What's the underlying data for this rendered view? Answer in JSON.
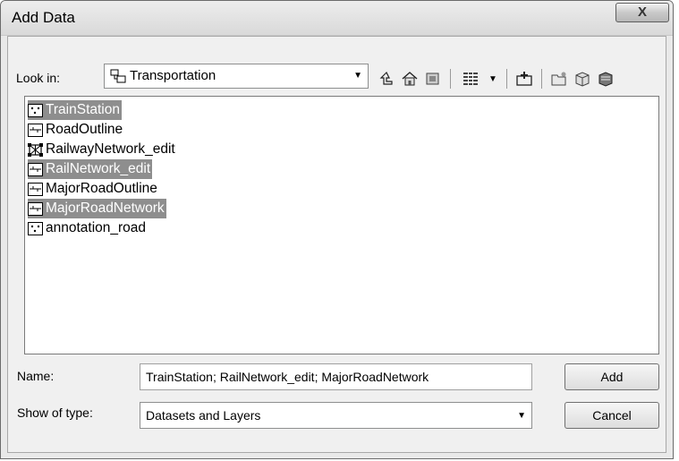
{
  "window": {
    "title": "Add Data",
    "close_label": "X"
  },
  "toolbar": {
    "look_in_label": "Look in:",
    "look_in_value": "Transportation",
    "buttons": [
      "up-one-level-icon",
      "home-icon",
      "catalog-icon",
      "view-options-icon",
      "new-folder-icon",
      "connect-folder-icon",
      "new-file-geodatabase-icon",
      "new-database-icon"
    ]
  },
  "list": {
    "items": [
      {
        "label": "TrainStation",
        "type": "point",
        "selected": true
      },
      {
        "label": "RoadOutline",
        "type": "line",
        "selected": false
      },
      {
        "label": "RailwayNetwork_edit",
        "type": "network",
        "selected": false
      },
      {
        "label": "RailNetwork_edit",
        "type": "line",
        "selected": true
      },
      {
        "label": "MajorRoadOutline",
        "type": "line",
        "selected": false
      },
      {
        "label": "MajorRoadNetwork",
        "type": "line",
        "selected": true
      },
      {
        "label": "annotation_road",
        "type": "point",
        "selected": false
      }
    ]
  },
  "form": {
    "name_label": "Name:",
    "name_value": "TrainStation; RailNetwork_edit; MajorRoadNetwork",
    "type_label": "Show of type:",
    "type_value": "Datasets and Layers"
  },
  "buttons": {
    "add": "Add",
    "cancel": "Cancel"
  },
  "colors": {
    "selection": "#8e8e8e",
    "dialog_bg": "#f0f0f0"
  }
}
